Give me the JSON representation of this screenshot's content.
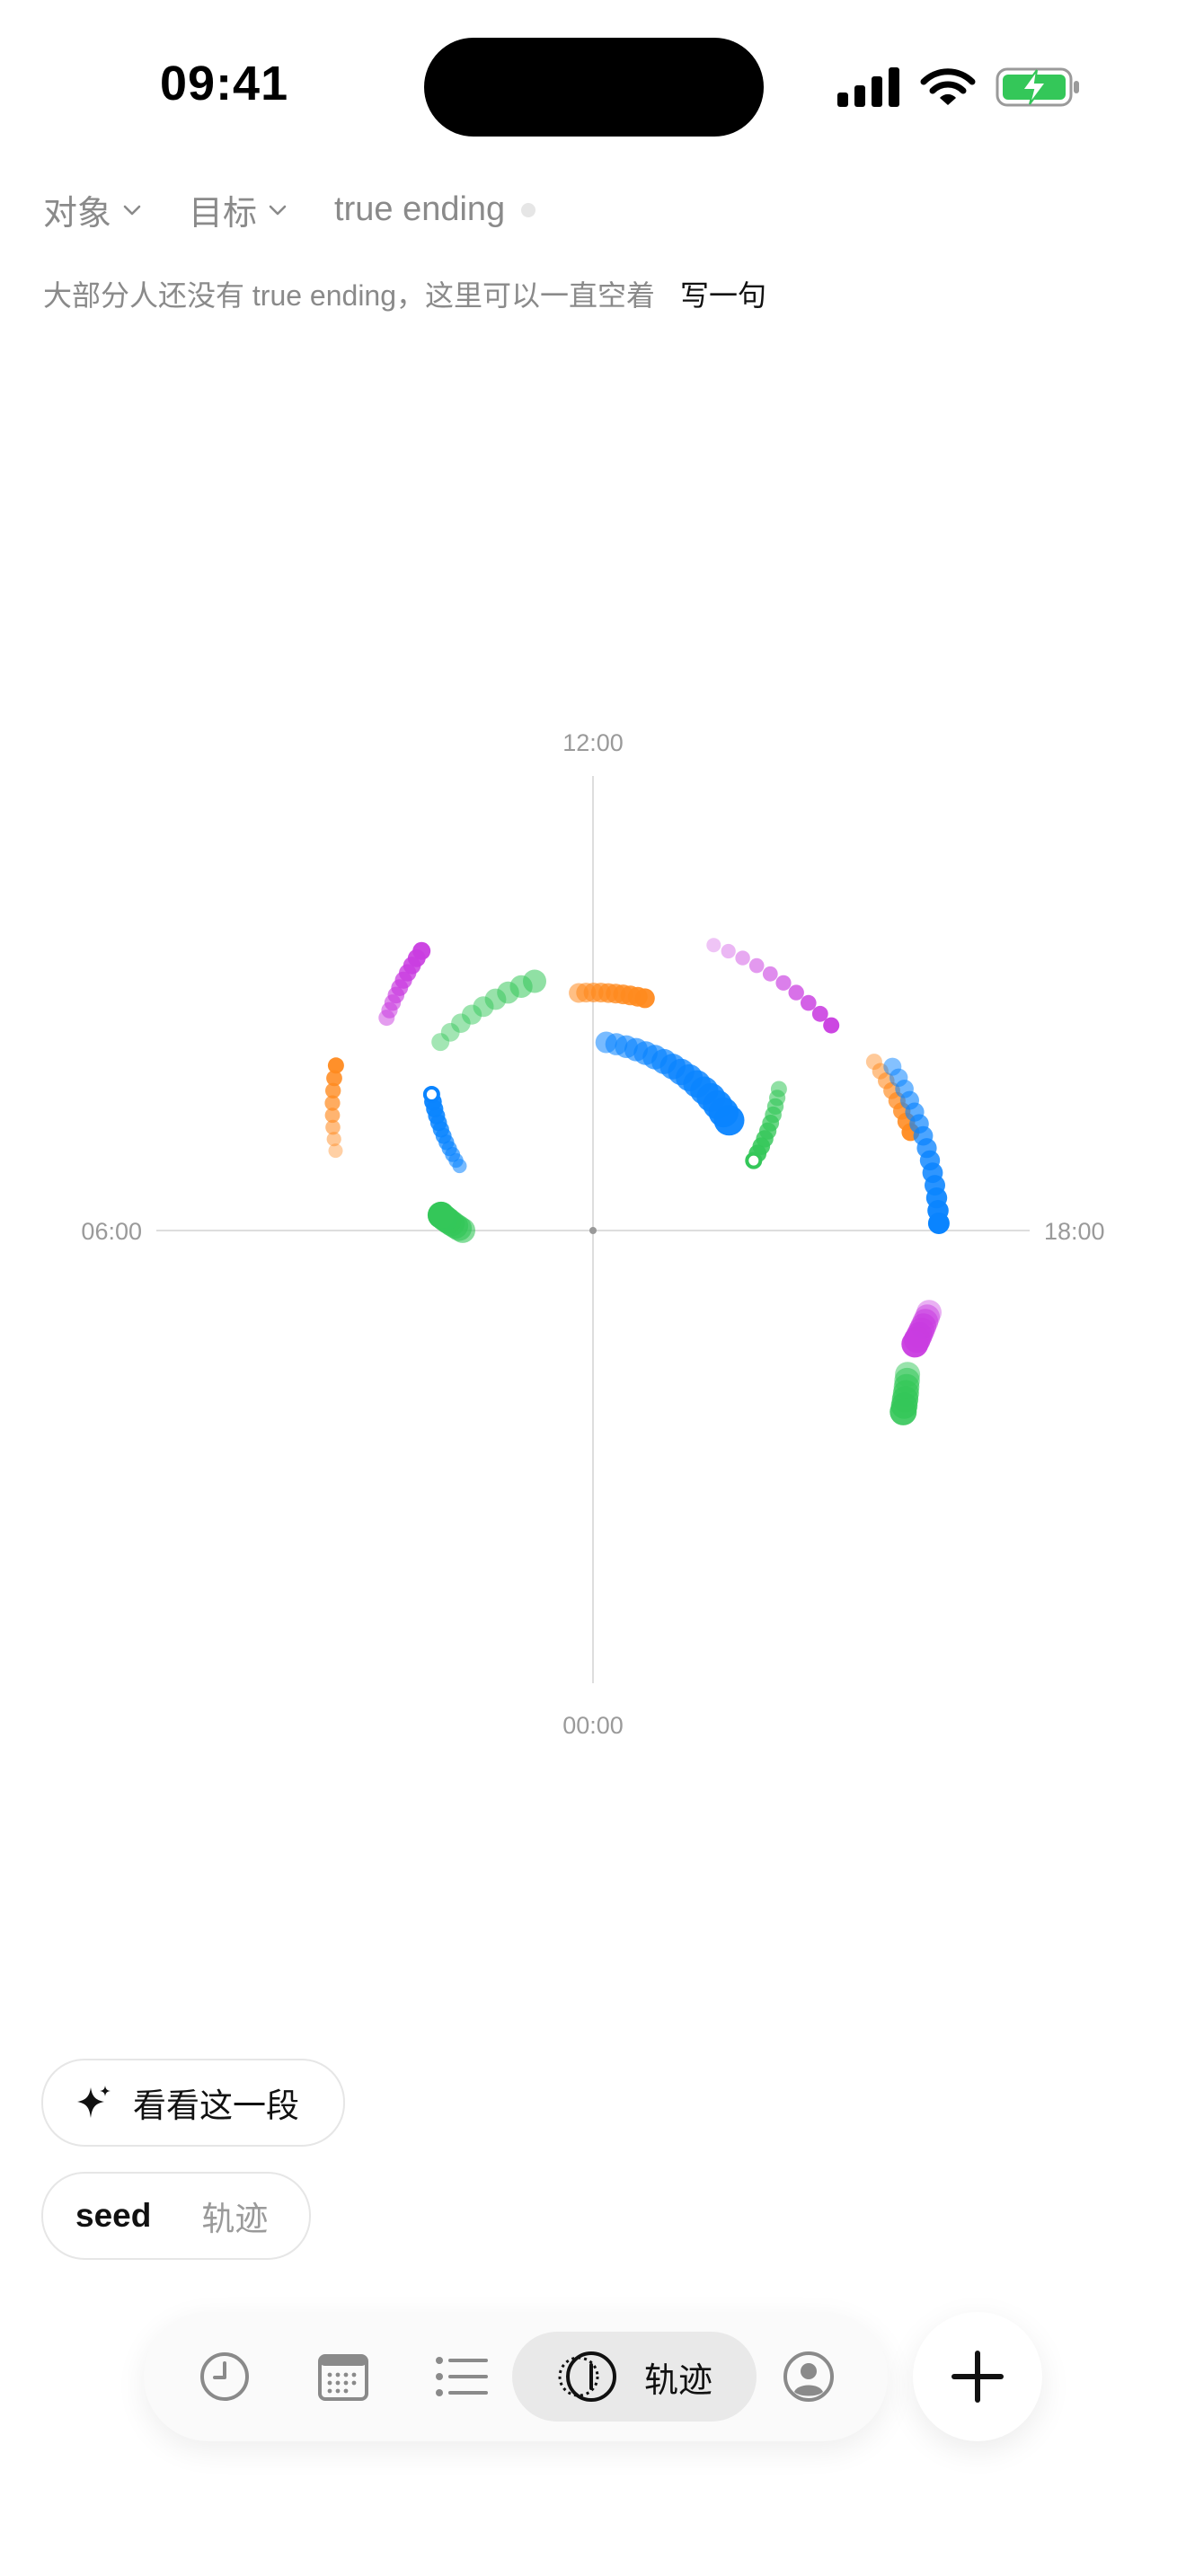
{
  "status_bar": {
    "time": "09:41"
  },
  "filters": {
    "target_label": "对象",
    "goal_label": "目标",
    "ending_label": "true ending"
  },
  "hint": {
    "text": "大部分人还没有 true ending，这里可以一直空着",
    "action": "写一句"
  },
  "chart_data": {
    "type": "scatter",
    "coordinate": "polar-clock",
    "axis_labels": {
      "top": "12:00",
      "left": "06:00",
      "right": "18:00",
      "bottom": "00:00"
    },
    "colors": {
      "green": "#34c759",
      "blue": "#0a84ff",
      "orange": "#ff8a1f",
      "purple": "#c93ce0"
    },
    "trails": [
      {
        "color": "green",
        "from": [
          -0.68,
          0.54,
          0.45
        ],
        "to": [
          -0.23,
          0.57,
          0.55
        ],
        "dots": 9,
        "r": [
          10,
          13
        ],
        "hollow_head": false
      },
      {
        "color": "blue",
        "from": [
          0.07,
          0.42,
          0.55
        ],
        "to": [
          0.89,
          0.39,
          0.95
        ],
        "dots": 16,
        "r": [
          12,
          17
        ],
        "hollow_head": false
      },
      {
        "color": "blue",
        "from": [
          -1.12,
          0.33,
          0.55
        ],
        "to": [
          -0.87,
          0.47,
          1.0
        ],
        "dots": 12,
        "r": [
          8,
          10
        ],
        "hollow_head": true
      },
      {
        "color": "green",
        "from": [
          -1.57,
          0.29,
          0.6
        ],
        "to": [
          -1.47,
          0.34,
          1.0
        ],
        "dots": 7,
        "r": [
          14,
          15
        ],
        "hollow_head": false
      },
      {
        "color": "green",
        "from": [
          0.92,
          0.52,
          0.55
        ],
        "to": [
          1.16,
          0.39,
          0.95
        ],
        "dots": 10,
        "r": [
          9,
          10
        ],
        "hollow_head": true
      },
      {
        "color": "orange",
        "from": [
          -0.06,
          0.53,
          0.55
        ],
        "to": [
          0.22,
          0.53,
          0.95
        ],
        "dots": 10,
        "r": [
          11,
          11
        ],
        "hollow_head": false
      },
      {
        "color": "orange",
        "from": [
          -1.27,
          0.6,
          0.4
        ],
        "to": [
          -1.0,
          0.68,
          0.95
        ],
        "dots": 8,
        "r": [
          8,
          9
        ],
        "hollow_head": false
      },
      {
        "color": "purple",
        "from": [
          -0.77,
          0.66,
          0.5
        ],
        "to": [
          -0.55,
          0.73,
          0.95
        ],
        "dots": 10,
        "r": [
          9,
          10
        ],
        "hollow_head": false
      },
      {
        "color": "purple",
        "from": [
          0.4,
          0.69,
          0.3
        ],
        "to": [
          0.86,
          0.7,
          0.95
        ],
        "dots": 10,
        "r": [
          8,
          9
        ],
        "hollow_head": false
      },
      {
        "color": "orange",
        "from": [
          1.03,
          0.73,
          0.45
        ],
        "to": [
          1.27,
          0.74,
          0.95
        ],
        "dots": 8,
        "r": [
          9,
          10
        ],
        "hollow_head": false
      },
      {
        "color": "blue",
        "from": [
          1.07,
          0.76,
          0.5
        ],
        "to": [
          1.55,
          0.77,
          1.0
        ],
        "dots": 14,
        "r": [
          10,
          12
        ],
        "hollow_head": false
      },
      {
        "color": "purple",
        "from": [
          1.81,
          0.77,
          0.4
        ],
        "to": [
          1.91,
          0.76,
          0.95
        ],
        "dots": 8,
        "r": [
          14,
          15
        ],
        "hollow_head": false
      },
      {
        "color": "green",
        "from": [
          2.0,
          0.77,
          0.5
        ],
        "to": [
          2.1,
          0.8,
          0.9
        ],
        "dots": 7,
        "r": [
          14,
          15
        ],
        "hollow_head": false
      }
    ]
  },
  "actions": {
    "insight_label": "看看这一段",
    "seed_label": "seed",
    "seed_trail_label": "轨迹"
  },
  "nav": {
    "active_label": "轨迹"
  }
}
